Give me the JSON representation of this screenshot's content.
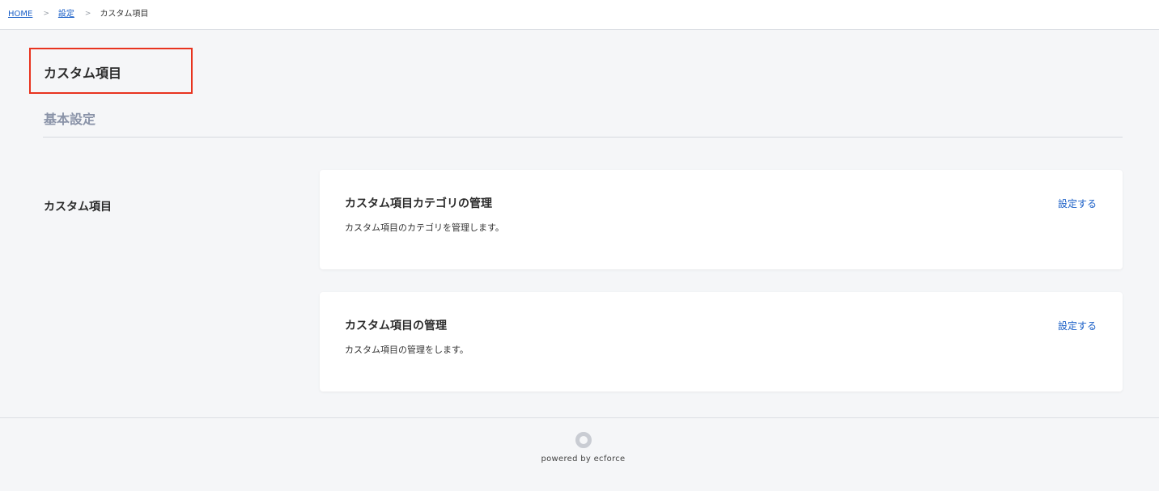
{
  "breadcrumb": {
    "items": [
      {
        "label": "HOME"
      },
      {
        "label": "設定"
      }
    ],
    "separator": ">",
    "current": "カスタム項目"
  },
  "page": {
    "title": "カスタム項目",
    "section_title": "基本設定"
  },
  "group": {
    "label": "カスタム項目",
    "cards": [
      {
        "title": "カスタム項目カテゴリの管理",
        "description": "カスタム項目のカテゴリを管理します。",
        "link_label": "設定する"
      },
      {
        "title": "カスタム項目の管理",
        "description": "カスタム項目の管理をします。",
        "link_label": "設定する"
      }
    ]
  },
  "footer": {
    "logo_icon": "ecforce-ring-icon",
    "text": "powered by ecforce"
  },
  "colors": {
    "accent_link": "#1a5fc7",
    "highlight_border": "#e8331f",
    "section_title": "#8a93a8",
    "background": "#f5f6f8"
  }
}
